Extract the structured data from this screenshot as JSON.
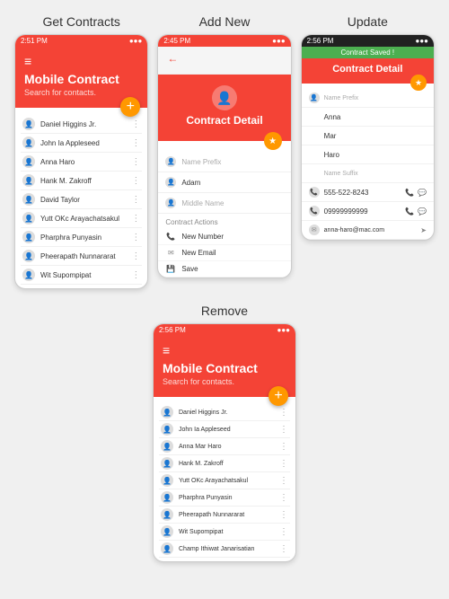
{
  "sections": [
    {
      "id": "get-contracts",
      "title": "Get Contracts",
      "statusBar": {
        "time": "2:51 PM",
        "icons": "●●●"
      },
      "header": {
        "appName": "Mobile Contract",
        "searchPlaceholder": "Search for contacts.",
        "menuIcon": "≡"
      },
      "fab": "+",
      "contacts": [
        "Daniel Higgins Jr.",
        "John Ia Appleseed",
        "Anna Haro",
        "Hank M. Zakroff",
        "David Taylor",
        "Yutt OKc Arayachatsakul",
        "Pharphra Punyasin",
        "Pheerapath Nunnararat",
        "Wit Supompipat"
      ]
    },
    {
      "id": "add-new",
      "title": "Add New",
      "statusBar": {
        "time": "2:45 PM",
        "icons": "●●●"
      },
      "header": {
        "back": "←",
        "title": "Contract Detail"
      },
      "avatar": {
        "icon": "👤"
      },
      "fields": [
        {
          "placeholder": "Name Prefix",
          "value": ""
        },
        {
          "placeholder": "",
          "value": "Adam"
        },
        {
          "placeholder": "Middle Name",
          "value": ""
        }
      ],
      "actionsTitle": "Contract Actions",
      "actions": [
        {
          "icon": "📞",
          "label": "New Number"
        },
        {
          "icon": "✉",
          "label": "New Email"
        },
        {
          "icon": "💾",
          "label": "Save"
        }
      ]
    },
    {
      "id": "update",
      "title": "Update",
      "statusBar": {
        "time": "2:56 PM",
        "icons": "●●●"
      },
      "savedBar": "Contract Saved !",
      "header": {
        "title": "Contract Detail"
      },
      "fields": [
        {
          "label": "Name Prefix",
          "value": ""
        },
        {
          "label": "",
          "value": "Anna"
        },
        {
          "label": "",
          "value": "Mar"
        },
        {
          "label": "",
          "value": "Haro"
        },
        {
          "label": "Name Suffix",
          "value": ""
        }
      ],
      "phoneNumbers": [
        {
          "number": "555-522-8243",
          "icons": [
            "📞",
            "✉"
          ]
        },
        {
          "number": "09999999999",
          "icons": [
            "📞",
            "✉"
          ]
        }
      ],
      "email": "anna-haro@mac.com"
    }
  ],
  "remove": {
    "title": "Remove",
    "statusBar": {
      "time": "2:56 PM",
      "icons": "●●●"
    },
    "header": {
      "appName": "Mobile Contract",
      "searchPlaceholder": "Search for contacts.",
      "menuIcon": "≡"
    },
    "fab": "+",
    "contacts": [
      "Daniel Higgins Jr.",
      "John Ia Appleseed",
      "Anna Mar Haro",
      "Hank M. Zakroff",
      "Yutt OKc Arayachatsakul",
      "Pharphra Punyasin",
      "Pheerapath Nunnararat",
      "Wit Supompipat",
      "Champ Ithiwat Janarisatian"
    ]
  }
}
